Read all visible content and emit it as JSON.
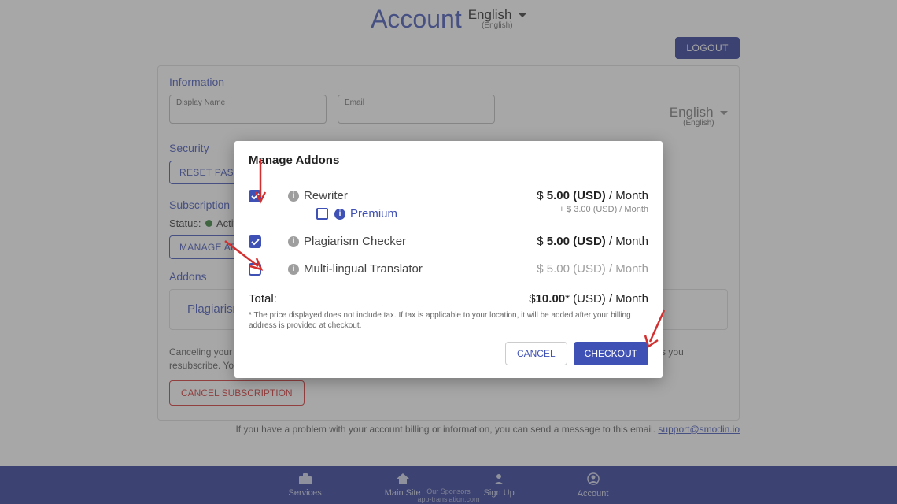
{
  "header": {
    "title": "Account",
    "lang": "English",
    "lang_sub": "(English)"
  },
  "logout": "LOGOUT",
  "sections": {
    "info_title": "Information",
    "display_name_label": "Display Name",
    "email_label": "Email",
    "lang_inline": "English",
    "lang_inline_sub": "(English)",
    "security_title": "Security",
    "reset_pw": "RESET PASSWORD",
    "sub_title": "Subscription",
    "status_label": "Status:",
    "status_value": "Active",
    "manage_addons_btn": "MANAGE ADDONS",
    "addons_title": "Addons",
    "addon_card_name": "Plagiarism",
    "cancel_note": "Canceling your subscription will delete your account at the end of the billing cycle. You will not be charged again unless you resubscribe. Your account and data will be lost at the end of the billing cycle.",
    "cancel_btn": "CANCEL SUBSCRIPTION"
  },
  "support": {
    "text": "If you have a problem with your account billing or information, you can send a message to this email. ",
    "email": "support@smodin.io"
  },
  "footer": {
    "services": "Services",
    "main_site": "Main Site",
    "sign_up": "Sign Up",
    "account": "Account",
    "sponsor1": "Our Sponsors",
    "sponsor2": "app-translation.com"
  },
  "modal": {
    "title": "Manage Addons",
    "addons": [
      {
        "label": "Rewriter",
        "checked": true,
        "price": "$ 5.00 (USD) / Month",
        "premium_label": "Premium",
        "premium_checked": false,
        "premium_price": "+ $ 3.00 (USD) / Month"
      },
      {
        "label": "Plagiarism Checker",
        "checked": true,
        "price": "$ 5.00 (USD) / Month"
      },
      {
        "label": "Multi-lingual Translator",
        "checked": false,
        "price": "$ 5.00 (USD) / Month"
      }
    ],
    "total_label": "Total:",
    "total_price_prefix": "$",
    "total_price_value": "10.00",
    "total_price_suffix": "* (USD) / Month",
    "disclaimer": "* The price displayed does not include tax. If tax is applicable to your location, it will be added after your billing address is provided at checkout.",
    "cancel": "CANCEL",
    "checkout": "CHECKOUT"
  }
}
